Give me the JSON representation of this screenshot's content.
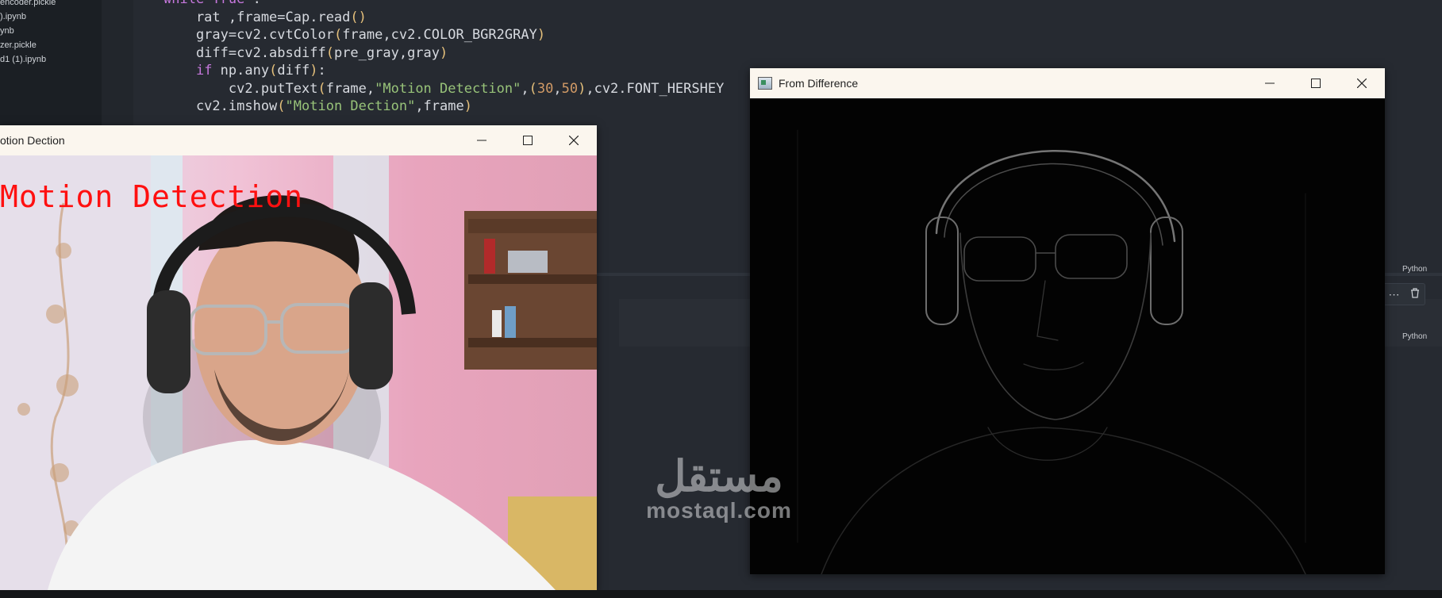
{
  "sidebar": {
    "files": [
      "encoder.pickle",
      ").ipynb",
      "ynb",
      "zer.pickle",
      "d1 (1).ipynb"
    ]
  },
  "editor": {
    "lines": [
      {
        "tokens": [
          {
            "t": "kw",
            "v": "while"
          },
          {
            "t": "n",
            "v": " "
          },
          {
            "t": "kw",
            "v": "True"
          },
          {
            "t": "n",
            "v": " :"
          }
        ]
      },
      {
        "tokens": [
          {
            "t": "n",
            "v": "    rat ,frame=Cap.read"
          },
          {
            "t": "par",
            "v": "()"
          }
        ]
      },
      {
        "tokens": [
          {
            "t": "n",
            "v": "    gray=cv2.cvtColor"
          },
          {
            "t": "par",
            "v": "("
          },
          {
            "t": "n",
            "v": "frame,cv2.COLOR_BGR2GRAY"
          },
          {
            "t": "par",
            "v": ")"
          }
        ]
      },
      {
        "tokens": [
          {
            "t": "n",
            "v": "    diff=cv2.absdiff"
          },
          {
            "t": "par",
            "v": "("
          },
          {
            "t": "n",
            "v": "pre_gray,gray"
          },
          {
            "t": "par",
            "v": ")"
          }
        ]
      },
      {
        "tokens": [
          {
            "t": "n",
            "v": "    "
          },
          {
            "t": "kw",
            "v": "if"
          },
          {
            "t": "n",
            "v": " np.any"
          },
          {
            "t": "par",
            "v": "("
          },
          {
            "t": "n",
            "v": "diff"
          },
          {
            "t": "par",
            "v": ")"
          },
          {
            "t": "n",
            "v": ":"
          }
        ]
      },
      {
        "tokens": [
          {
            "t": "n",
            "v": "        cv2.putText"
          },
          {
            "t": "par",
            "v": "("
          },
          {
            "t": "n",
            "v": "frame,"
          },
          {
            "t": "str",
            "v": "\"Motion Detection\""
          },
          {
            "t": "n",
            "v": ","
          },
          {
            "t": "par",
            "v": "("
          },
          {
            "t": "num",
            "v": "30"
          },
          {
            "t": "n",
            "v": ","
          },
          {
            "t": "num",
            "v": "50"
          },
          {
            "t": "par",
            "v": ")"
          },
          {
            "t": "n",
            "v": ",cv2.FONT_HERSHEY"
          }
        ]
      },
      {
        "tokens": [
          {
            "t": "n",
            "v": "    cv2.imshow"
          },
          {
            "t": "par",
            "v": "("
          },
          {
            "t": "str",
            "v": "\"Motion Dection\""
          },
          {
            "t": "n",
            "v": ",frame"
          },
          {
            "t": "par",
            "v": ")"
          }
        ]
      }
    ]
  },
  "cells": {
    "lang1": "Python",
    "lang2": "Python"
  },
  "windows": {
    "motion": {
      "title": "otion Dection",
      "overlay": "Motion Detection"
    },
    "diff": {
      "title": "From Difference"
    }
  },
  "watermark": {
    "arabic": "مستقل",
    "domain": "mostaql.com"
  },
  "icons": [
    "minimize-icon",
    "maximize-icon",
    "close-icon",
    "app-icon",
    "trash-icon",
    "more-icon"
  ]
}
